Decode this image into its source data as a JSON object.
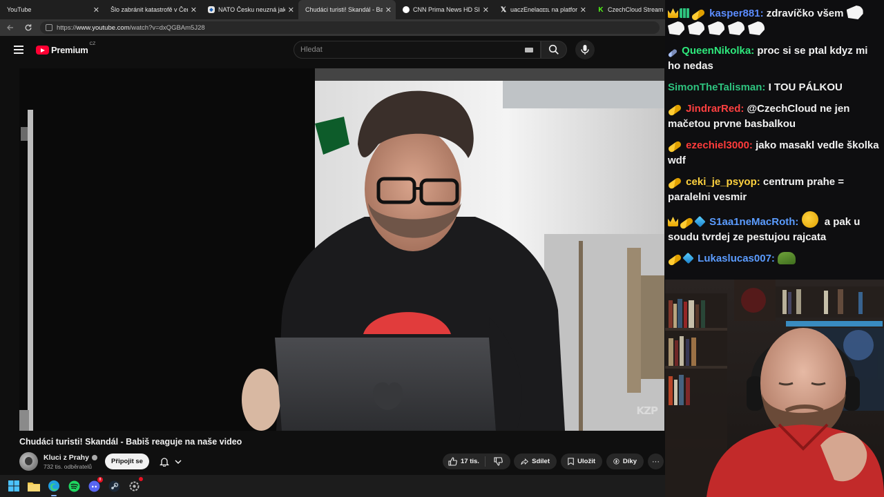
{
  "browser": {
    "tabs": [
      {
        "title": "YouTube",
        "icon": "youtube-icon",
        "active": false
      },
      {
        "title": "Šlo zabránit katastrofě v Čern",
        "icon": "youtube-icon",
        "active": false
      },
      {
        "title": "NATO Česku neuzná jako o",
        "icon": "nato-icon",
        "active": false
      },
      {
        "title": "Chudáci turisti! Skandál - Babi",
        "icon": "youtube-icon",
        "active": true
      },
      {
        "title": "CNN Prima News HD Sleduj",
        "icon": "cnn-icon",
        "active": false
      },
      {
        "title": "uaczEnelaɑɪɪʟ na platformě X",
        "icon": "x-icon",
        "active": false
      },
      {
        "title": "CzechCloud Stream - Wa",
        "icon": "kick-icon",
        "active": false
      }
    ],
    "url_prefix": "https://",
    "url_host": "www.youtube.com",
    "url_path": "/watch?v=dxQGBAm5J28"
  },
  "youtube": {
    "logo_text": "Premium",
    "logo_country": "CZ",
    "search_placeholder": "Hledat",
    "video_title": "Chudáci turisti! Skandál - Babiš reaguje na naše video",
    "watermark": "KZP",
    "channel_name": "Kluci z Prahy",
    "subscribers": "732 tis. odběratelů",
    "join_label": "Připojit se",
    "like_count": "17 tis.",
    "share_label": "Sdílet",
    "save_label": "Uložit",
    "thanks_label": "Díky",
    "more_label": "···"
  },
  "taskbar": {
    "icons": [
      "windows-start-icon",
      "file-explorer-icon",
      "edge-icon",
      "spotify-icon",
      "discord-icon",
      "steam-icon",
      "settings-icon"
    ],
    "discord_badge": "8"
  },
  "chat": {
    "messages": [
      {
        "badges": [
          "crown",
          "grid",
          "pill"
        ],
        "user": "kasper881",
        "color": "#5b8cff",
        "text": "zdravíčko všem",
        "emotes_after": 6
      },
      {
        "badges": [
          "wand"
        ],
        "user": "QueenNikolka",
        "color": "#2ee87c",
        "text": "proc si se ptal kdyz mi ho nedas"
      },
      {
        "badges": [],
        "user": "SimonTheTalisman",
        "color": "#2ec27e",
        "text": "I TOU PÁLKOU"
      },
      {
        "badges": [
          "pill"
        ],
        "user": "JindrarRed",
        "color": "#ff4040",
        "text": "@CzechCloud ne jen mačetou prvne basbalkou"
      },
      {
        "badges": [
          "pill"
        ],
        "user": "ezechiel3000",
        "color": "#ff3b3b",
        "text": "jako masakl vedle školka wdf"
      },
      {
        "badges": [
          "pill"
        ],
        "user": "ceki_je_psyop",
        "color": "#ffd23f",
        "text": "centrum prahe = paralelni vesmir"
      },
      {
        "badges": [
          "crown",
          "pill",
          "gem"
        ],
        "user": "S1aa1neMacRoth",
        "color": "#5b9cff",
        "text": "a pak u soudu tvrdej ze pestujou rajcata",
        "emote_before": "duck"
      },
      {
        "badges": [
          "pill",
          "gem"
        ],
        "user": "Lukaslucas007",
        "color": "#5b9cff",
        "text": "",
        "emote_before": "frog"
      }
    ]
  }
}
